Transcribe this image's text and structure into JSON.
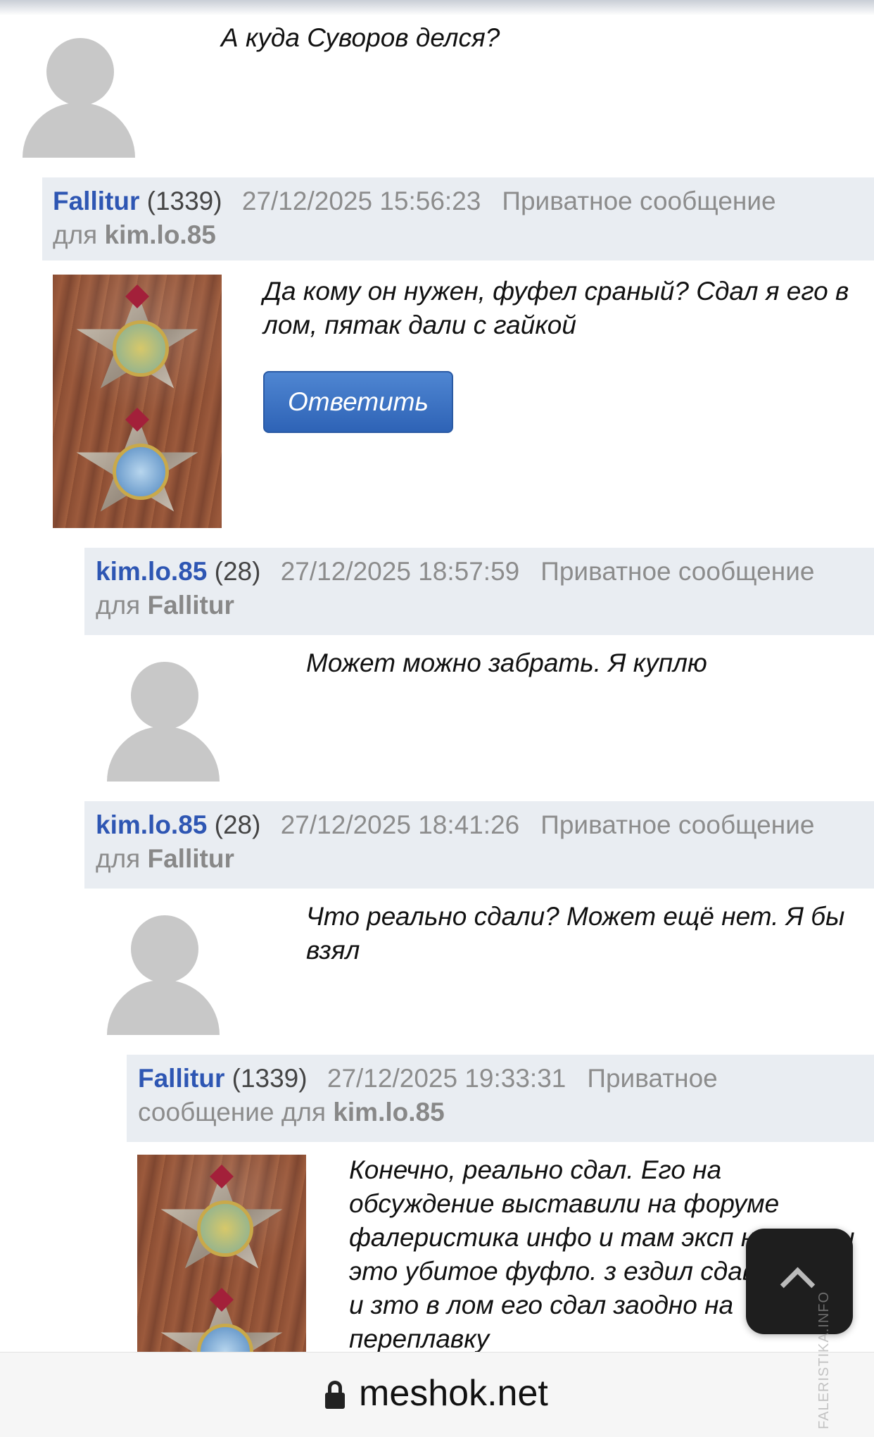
{
  "posts": [
    {
      "message": "А куда Суворов делся?"
    },
    {
      "username": "Fallitur",
      "rating": "1339",
      "datetime": "27/12/2025 15:56:23",
      "private_label": "Приватное сообщение",
      "for_label": "для",
      "recipient": "kim.lo.85",
      "message": "Да кому он нужен, фуфел сраный? Сдал я его в лом, пятак дали с гайкой",
      "reply_button": "Ответить"
    },
    {
      "username": "kim.lo.85",
      "rating": "28",
      "datetime": "27/12/2025 18:57:59",
      "private_label": "Приватное сообщение",
      "for_label": "для",
      "recipient": "Fallitur",
      "message": "Может можно забрать. Я куплю"
    },
    {
      "username": "kim.lo.85",
      "rating": "28",
      "datetime": "27/12/2025 18:41:26",
      "private_label": "Приватное сообщение",
      "for_label": "для",
      "recipient": "Fallitur",
      "message": "Что реально сдали? Может ещё нет. Я бы взял"
    },
    {
      "username": "Fallitur",
      "rating": "1339",
      "datetime": "27/12/2025 19:33:31",
      "private_label": "Приватное",
      "private_label2": "сообщение",
      "for_label": "для",
      "recipient": "kim.lo.85",
      "message": "Конечно, реально сдал. Его на обсуждение выставили на форуме фалеристика инфо и там эксп написали это убитое фуфло. з ездил сдавать збз и зто в лом его сдал заодно на переплавку"
    }
  ],
  "browser": {
    "domain": "meshok.net"
  },
  "watermark": "FALERISTIKA.INFO",
  "icons": {
    "scroll_top": "chevron-up-icon",
    "lock": "lock-icon"
  },
  "colors": {
    "username": "#2e56b3",
    "header_bg": "#e9edf2",
    "button": "#3a6fc2"
  }
}
